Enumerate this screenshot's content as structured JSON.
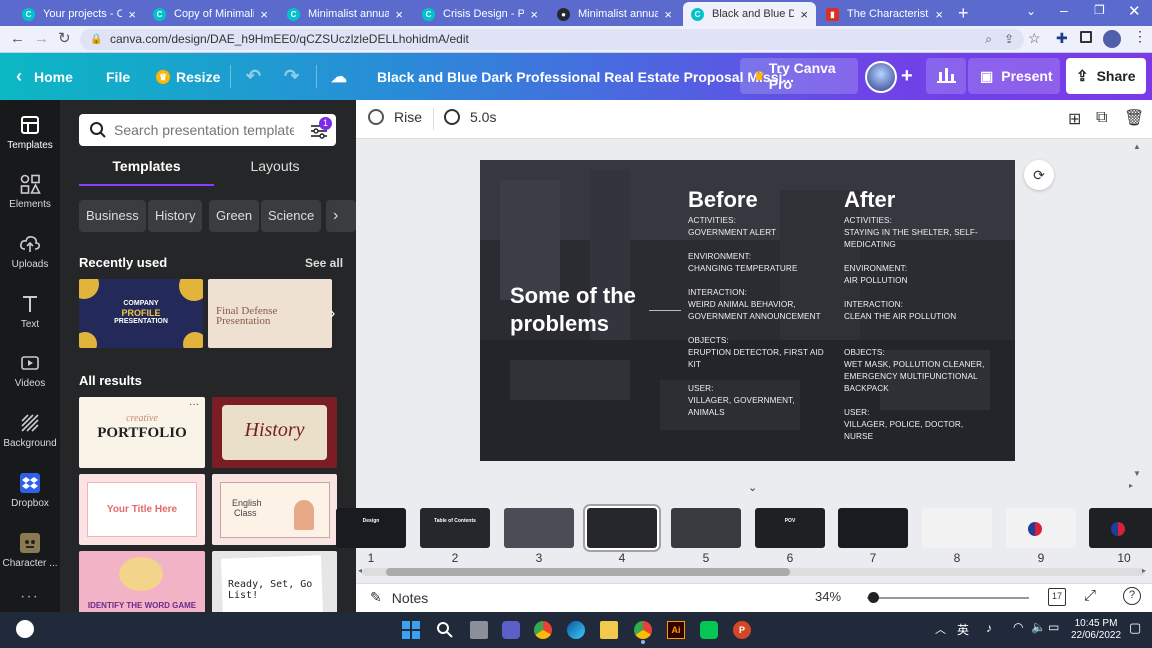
{
  "browser": {
    "tabs": [
      {
        "title": "Your projects - Canva",
        "favicon": "canva-icon",
        "color": "#00c4cc",
        "active": false
      },
      {
        "title": "Copy of Minimalist an",
        "favicon": "canva-icon",
        "color": "#00c4cc",
        "active": false
      },
      {
        "title": "Minimalist annual rep",
        "favicon": "canva-icon",
        "color": "#00c4cc",
        "active": false
      },
      {
        "title": "Crisis Design - Presen",
        "favicon": "canva-icon",
        "color": "#00c4cc",
        "active": false
      },
      {
        "title": "Minimalist annual rep",
        "favicon": "github-icon",
        "color": "#24292f",
        "active": false
      },
      {
        "title": "Black and Blue Dark P",
        "favicon": "canva-icon",
        "color": "#00c4cc",
        "active": true
      },
      {
        "title": "The Characteristics of",
        "favicon": "bookmark-icon",
        "color": "#d93025",
        "active": false
      }
    ],
    "url": "canva.com/design/DAE_h9HmEE0/qCZSUczlzleDELLhohidmA/edit"
  },
  "header": {
    "home": "Home",
    "file": "File",
    "resize": "Resize",
    "title": "Black and Blue Dark Professional Real Estate Proposal Missi...",
    "try_pro": "Try Canva Pro",
    "present": "Present",
    "share": "Share"
  },
  "rail": [
    {
      "label": "Templates",
      "icon": "templates-icon"
    },
    {
      "label": "Elements",
      "icon": "elements-icon"
    },
    {
      "label": "Uploads",
      "icon": "upload-cloud-icon"
    },
    {
      "label": "Text",
      "icon": "text-icon"
    },
    {
      "label": "Videos",
      "icon": "video-icon"
    },
    {
      "label": "Background",
      "icon": "background-icon"
    },
    {
      "label": "Dropbox",
      "icon": "dropbox-icon"
    },
    {
      "label": "Character ...",
      "icon": "character-icon"
    }
  ],
  "panel": {
    "search_placeholder": "Search presentation templates",
    "filter_badge": "1",
    "tabs": [
      "Templates",
      "Layouts"
    ],
    "chips": [
      "Business",
      "History",
      "Green",
      "Science"
    ],
    "recently_used": "Recently used",
    "see_all": "See all",
    "all_results": "All results",
    "recent": [
      {
        "line1": "COMPANY",
        "line2": "PROFILE",
        "line3": "PRESENTATION"
      },
      {
        "line1": "Final Defense",
        "line2": "Presentation"
      }
    ],
    "results": [
      {
        "line1": "creative",
        "line2": "PORTFOLIO"
      },
      {
        "line1": "History"
      },
      {
        "line1": "Your Title Here"
      },
      {
        "line1": "English",
        "line2": "Class"
      },
      {
        "line1": "IDENTIFY THE WORD GAME"
      },
      {
        "line1": "Ready, Set, Go List!"
      }
    ]
  },
  "toolbar": {
    "animation": "Rise",
    "duration": "5.0s"
  },
  "slide": {
    "heading_line1": "Some of the",
    "heading_line2": "problems",
    "before": {
      "title": "Before",
      "lines": [
        "ACTIVITIES:",
        "GOVERNMENT ALERT",
        "",
        "ENVIRONMENT:",
        "CHANGING TEMPERATURE",
        "",
        "INTERACTION:",
        "WEIRD ANIMAL BEHAVIOR,",
        "GOVERNMENT ANNOUNCEMENT",
        "",
        "OBJECTS:",
        "ERUPTION DETECTOR, FIRST AID",
        "KIT",
        "",
        "USER:",
        "VILLAGER, GOVERNMENT,",
        "ANIMALS"
      ]
    },
    "after": {
      "title": "After",
      "lines": [
        "ACTIVITIES:",
        "STAYING IN THE SHELTER, SELF-",
        "MEDICATING",
        "",
        "ENVIRONMENT:",
        "AIR POLLUTION",
        "",
        "INTERACTION:",
        " CLEAN THE AIR POLLUTION",
        "",
        "",
        "OBJECTS:",
        "WET MASK, POLLUTION CLEANER,",
        "EMERGENCY MULTIFUNCTIONAL",
        "BACKPACK",
        "",
        "USER:",
        "VILLAGER, POLICE, DOCTOR, NURSE"
      ]
    }
  },
  "filmstrip": [
    {
      "num": "1",
      "label": "Design"
    },
    {
      "num": "2",
      "label": "Table of Contents"
    },
    {
      "num": "3",
      "label": ""
    },
    {
      "num": "4",
      "label": "",
      "active": true
    },
    {
      "num": "5",
      "label": ""
    },
    {
      "num": "6",
      "label": "POV"
    },
    {
      "num": "7",
      "label": ""
    },
    {
      "num": "8",
      "label": ""
    },
    {
      "num": "9",
      "label": ""
    },
    {
      "num": "10",
      "label": ""
    }
  ],
  "footer": {
    "notes": "Notes",
    "zoom": "34%",
    "page_count": "17",
    "zoom_level": 0.04
  },
  "taskbar": {
    "time": "10:45 PM",
    "date": "22/06/2022",
    "lang": "英"
  }
}
